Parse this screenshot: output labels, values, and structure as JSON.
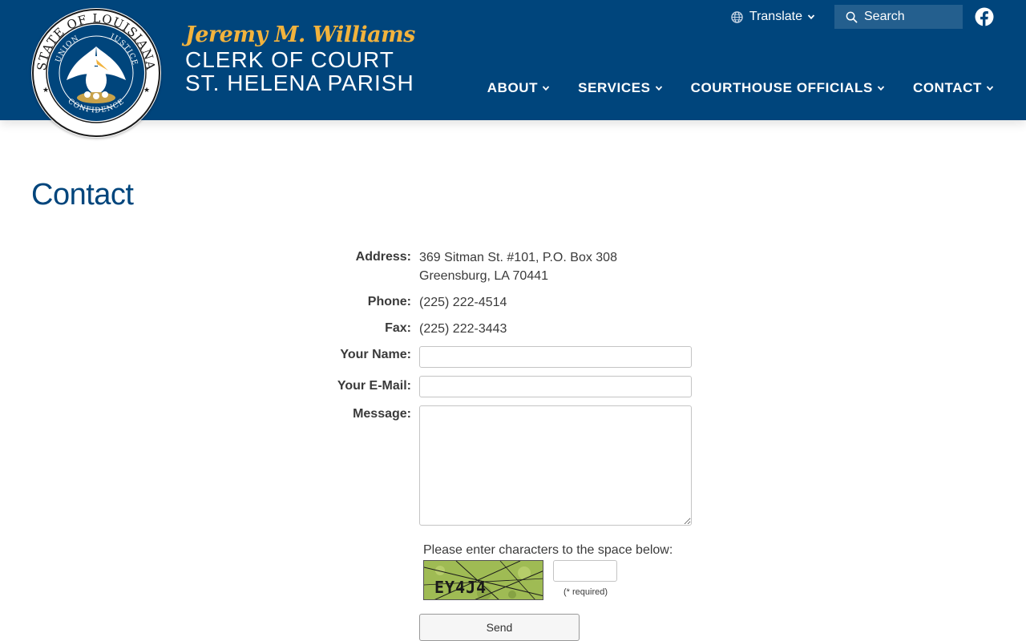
{
  "header": {
    "seal_icon": "louisiana-state-seal",
    "seal_text_top": "STATE OF LOUISIANA",
    "seal_text_motto_left": "UNION",
    "seal_text_motto_right": "JUSTICE",
    "seal_text_bottom": "CONFIDENCE",
    "clerk_name": "Jeremy M. Williams",
    "title_line1": "CLERK OF COURT",
    "title_line2": "ST. HELENA PARISH",
    "translate_label": "Translate",
    "search_label": "Search",
    "facebook_icon": "facebook-icon",
    "nav": [
      {
        "label": "ABOUT"
      },
      {
        "label": "SERVICES"
      },
      {
        "label": "COURTHOUSE OFFICIALS"
      },
      {
        "label": "CONTACT"
      }
    ]
  },
  "page": {
    "title": "Contact"
  },
  "contact": {
    "address_label": "Address:",
    "address_line1": "369 Sitman St. #101, P.O. Box 308",
    "address_line2": "Greensburg, LA 70441",
    "phone_label": "Phone:",
    "phone_value": "(225) 222-4514",
    "fax_label": "Fax:",
    "fax_value": "(225) 222-3443"
  },
  "form": {
    "name_label": "Your Name:",
    "name_value": "",
    "email_label": "Your E-Mail:",
    "email_value": "",
    "message_label": "Message:",
    "message_value": "",
    "captcha_prompt": "Please enter characters to the space below:",
    "captcha_text": "EY4J4",
    "captcha_value": "",
    "required_note": "(* required)",
    "send_label": "Send"
  },
  "colors": {
    "header_bg": "#00457c",
    "accent_gold": "#f2b33d",
    "title_blue": "#00457c"
  }
}
